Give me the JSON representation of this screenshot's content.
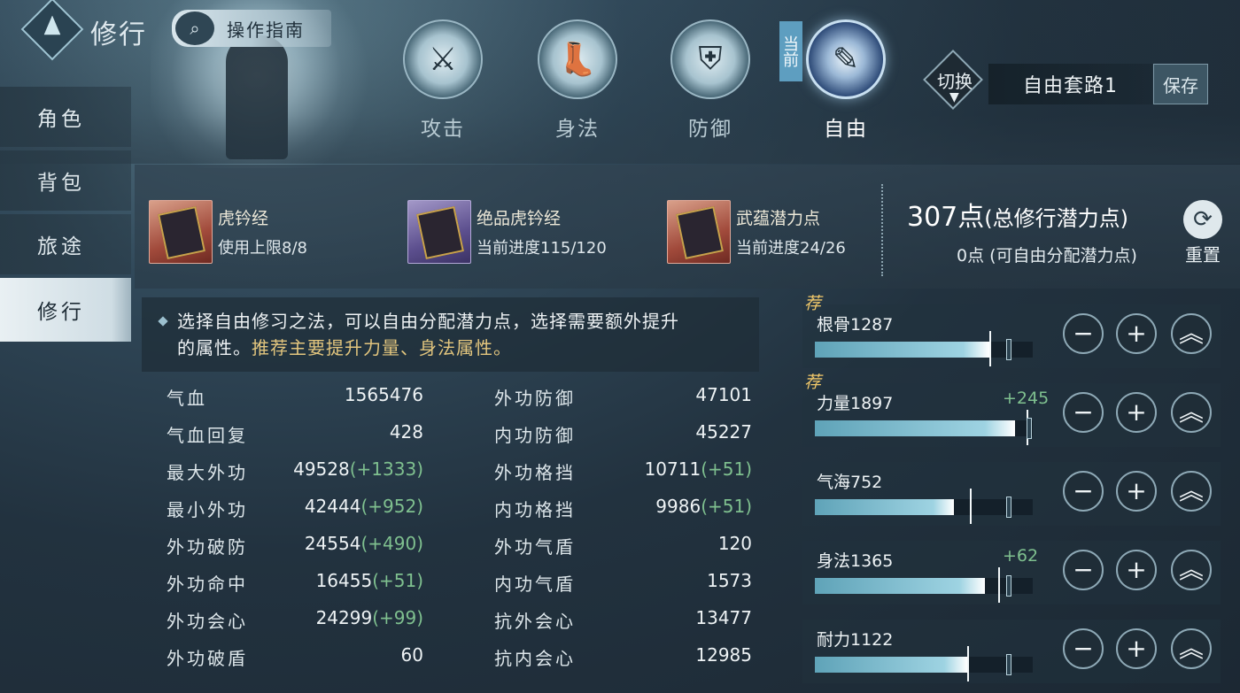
{
  "header": {
    "title": "修行",
    "guide_label": "操作指南"
  },
  "tabs": [
    {
      "label": "攻击",
      "icon": "sword-icon",
      "glyph": "⚔"
    },
    {
      "label": "身法",
      "icon": "boot-icon",
      "glyph": "👢"
    },
    {
      "label": "防御",
      "icon": "shield-icon",
      "glyph": "⛨"
    },
    {
      "label": "自由",
      "icon": "book-brush-icon",
      "glyph": "✎"
    }
  ],
  "current_flag": "当前",
  "preset": {
    "switch_label": "切换",
    "name": "自由套路1",
    "save_label": "保存"
  },
  "sidebar": {
    "items": [
      {
        "label": "角色"
      },
      {
        "label": "背包"
      },
      {
        "label": "旅途"
      },
      {
        "label": "修行"
      }
    ]
  },
  "items": [
    {
      "name": "虎钤经",
      "desc": "使用上限8/8",
      "quality": "red"
    },
    {
      "name": "绝品虎钤经",
      "desc": "当前进度115/120",
      "quality": "purple"
    },
    {
      "name": "武蕴潜力点",
      "desc": "当前进度24/26",
      "quality": "red"
    }
  ],
  "points": {
    "total_value": "307点",
    "total_label": "(总修行潜力点)",
    "free": "0点 (可自由分配潜力点)",
    "reset_label": "重置"
  },
  "tip": {
    "line1": "选择自由修习之法，可以自由分配潜力点，选择需要额外提升",
    "line2_plain": "的属性。",
    "line2_highlight": "推荐主要提升力量、身法属性。"
  },
  "stats_left": [
    {
      "label": "气血",
      "value": "1565476",
      "bonus": ""
    },
    {
      "label": "气血回复",
      "value": "428",
      "bonus": ""
    },
    {
      "label": "最大外功",
      "value": "49528",
      "bonus": "(+1333)"
    },
    {
      "label": "最小外功",
      "value": "42444",
      "bonus": "(+952)"
    },
    {
      "label": "外功破防",
      "value": "24554",
      "bonus": "(+490)"
    },
    {
      "label": "外功命中",
      "value": "16455",
      "bonus": "(+51)"
    },
    {
      "label": "外功会心",
      "value": "24299",
      "bonus": "(+99)"
    },
    {
      "label": "外功破盾",
      "value": "60",
      "bonus": ""
    }
  ],
  "stats_right": [
    {
      "label": "外功防御",
      "value": "47101",
      "bonus": ""
    },
    {
      "label": "内功防御",
      "value": "45227",
      "bonus": ""
    },
    {
      "label": "外功格挡",
      "value": "10711",
      "bonus": "(+51)"
    },
    {
      "label": "内功格挡",
      "value": "9986",
      "bonus": "(+51)"
    },
    {
      "label": "外功气盾",
      "value": "120",
      "bonus": ""
    },
    {
      "label": "内功气盾",
      "value": "1573",
      "bonus": ""
    },
    {
      "label": "抗外会心",
      "value": "13477",
      "bonus": ""
    },
    {
      "label": "抗内会心",
      "value": "12985",
      "bonus": ""
    }
  ],
  "attributes": [
    {
      "name": "根骨1287",
      "bonus": "",
      "recommended": true,
      "rec_label": "荐",
      "fill": 0.8,
      "cap": 0.8,
      "mark": 0.88
    },
    {
      "name": "力量1897",
      "bonus": "+245",
      "recommended": true,
      "rec_label": "荐",
      "fill": 0.92,
      "cap": 0.97,
      "mark": 0.97
    },
    {
      "name": "气海752",
      "bonus": "",
      "recommended": false,
      "rec_label": "",
      "fill": 0.64,
      "cap": 0.71,
      "mark": 0.88
    },
    {
      "name": "身法1365",
      "bonus": "+62",
      "recommended": false,
      "rec_label": "",
      "fill": 0.78,
      "cap": 0.84,
      "mark": 0.88
    },
    {
      "name": "耐力1122",
      "bonus": "",
      "recommended": false,
      "rec_label": "",
      "fill": 0.7,
      "cap": 0.7,
      "mark": 0.88
    }
  ],
  "controls": {
    "minus": "−",
    "plus": "+",
    "max": "︽"
  }
}
